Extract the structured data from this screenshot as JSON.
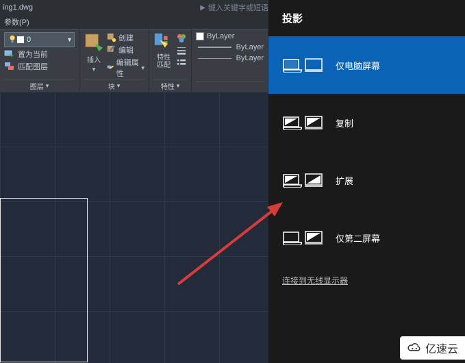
{
  "cad": {
    "title_file": "ing1.dwg",
    "search_placeholder": "键入关键字或短语",
    "menu": {
      "param": "参数(P)"
    },
    "ribbon": {
      "layer": {
        "current": "0",
        "set_current": "置为当前",
        "match_layer": "匹配图层",
        "foot": "图层"
      },
      "block": {
        "insert": "插入",
        "create": "创建",
        "edit": "编辑",
        "edit_attr": "编辑属性",
        "foot": "块"
      },
      "props": {
        "match": "特性\n匹配",
        "foot": "特性"
      },
      "layerprops": {
        "bylayer1": "ByLayer",
        "bylayer2": "ByLayer",
        "bylayer3": "ByLayer"
      }
    }
  },
  "project": {
    "title": "投影",
    "options": [
      {
        "label": "仅电脑屏幕",
        "key": "pc-only"
      },
      {
        "label": "复制",
        "key": "duplicate"
      },
      {
        "label": "扩展",
        "key": "extend"
      },
      {
        "label": "仅第二屏幕",
        "key": "second-only"
      }
    ],
    "wireless": "连接到无线显示器"
  },
  "watermark": "亿速云"
}
